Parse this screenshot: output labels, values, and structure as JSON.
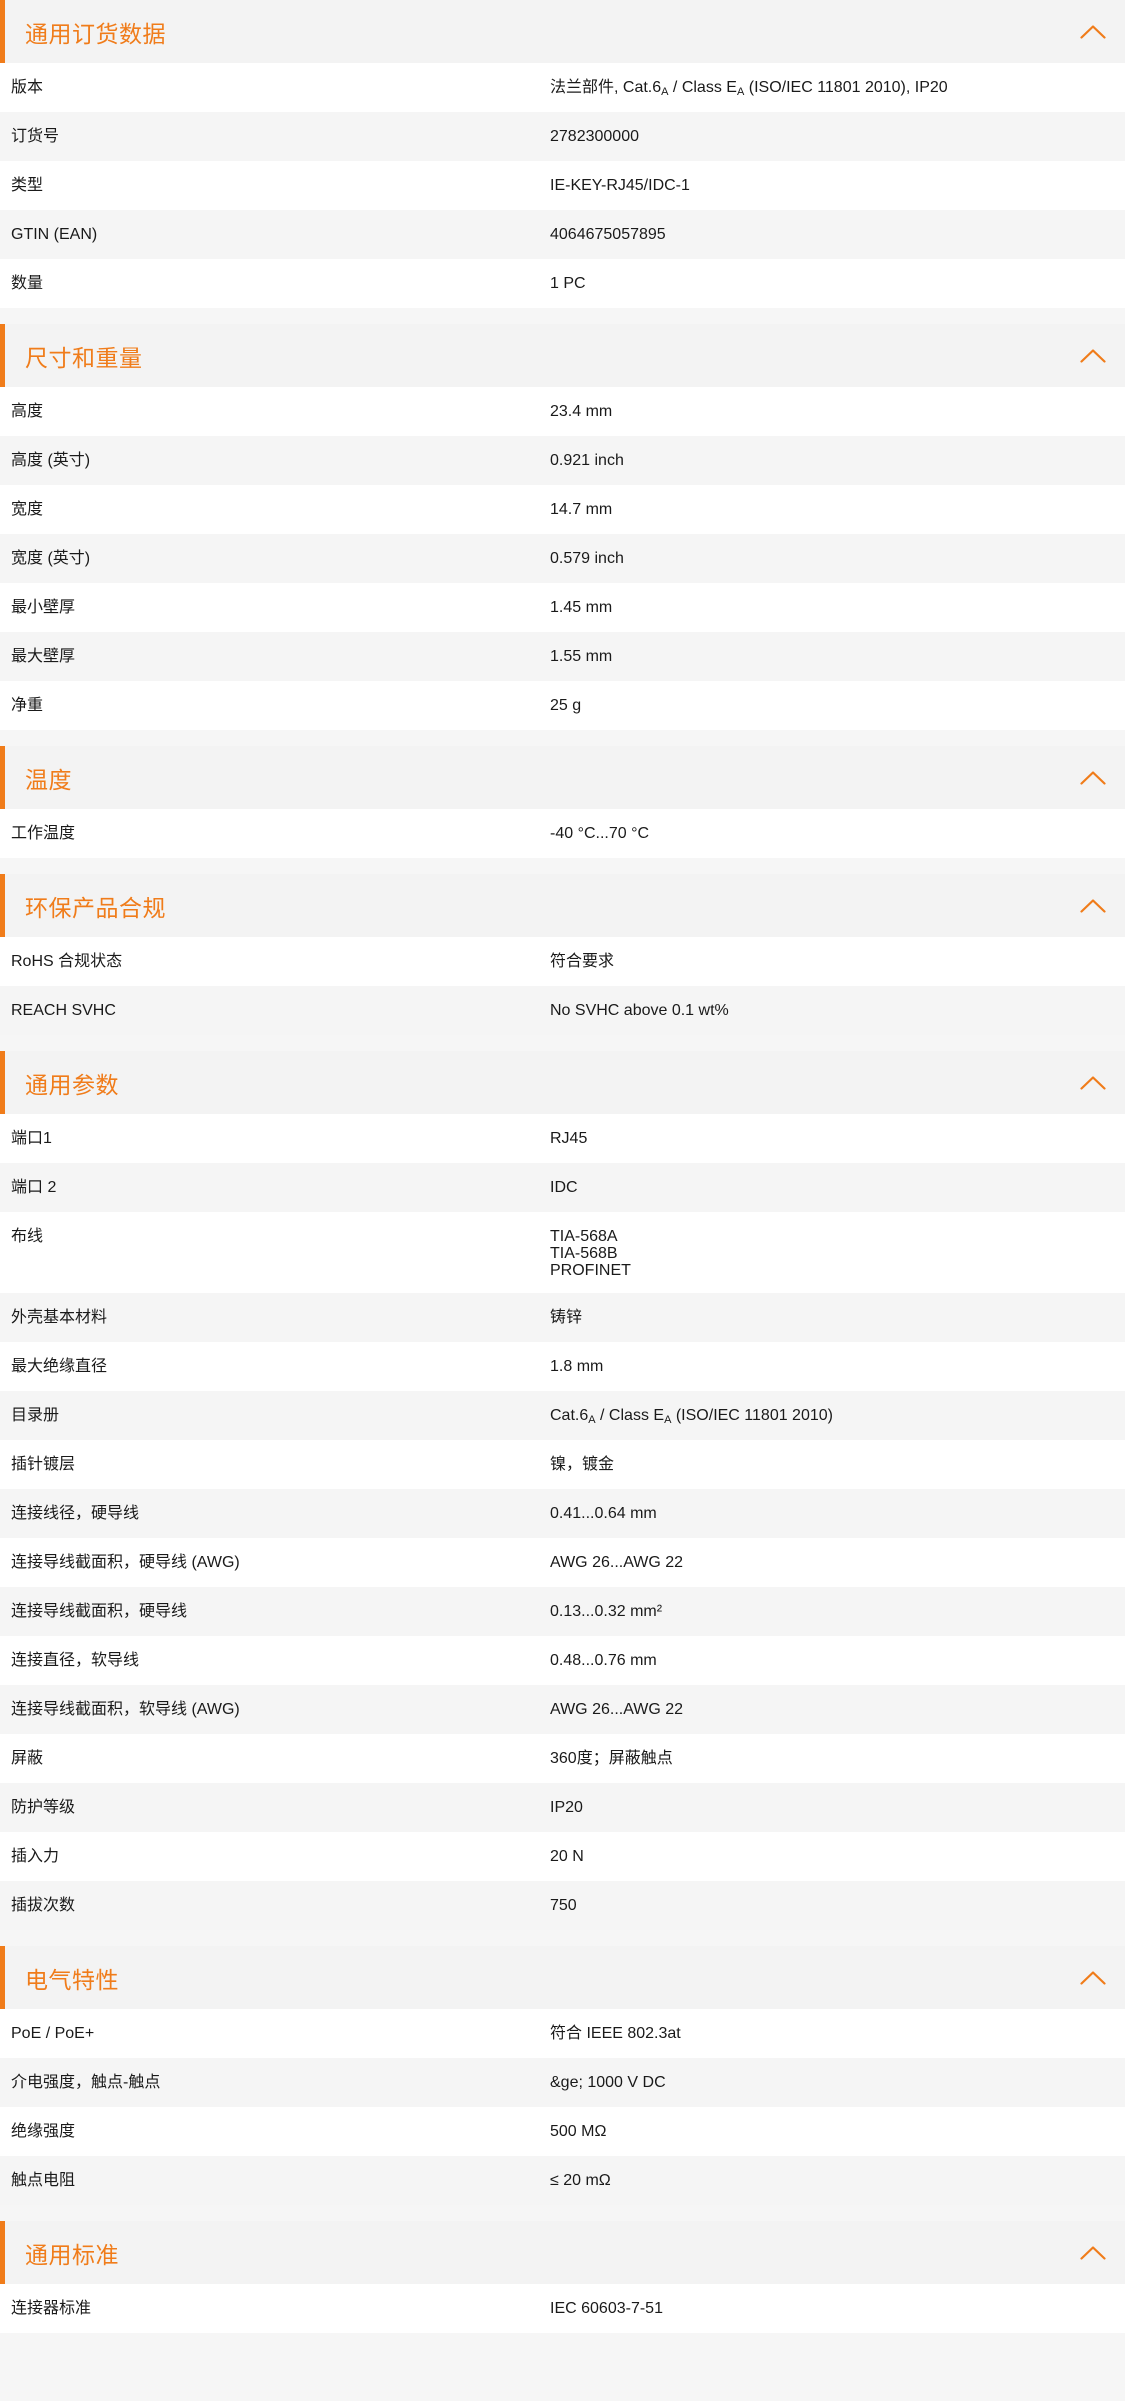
{
  "sections": [
    {
      "title": "通用订货数据",
      "rows": [
        {
          "label": "版本",
          "value": [
            "法兰部件, Cat.6",
            "A",
            " / Class E",
            "A",
            " (ISO/IEC 11801 2010), IP20"
          ]
        },
        {
          "label": "订货号",
          "value": [
            "2782300000"
          ]
        },
        {
          "label": "类型",
          "value": [
            "IE-KEY-RJ45/IDC-1"
          ]
        },
        {
          "label": "GTIN (EAN)",
          "value": [
            "4064675057895"
          ]
        },
        {
          "label": "数量",
          "value": [
            "1  PC"
          ]
        }
      ]
    },
    {
      "title": "尺寸和重量",
      "rows": [
        {
          "label": "高度",
          "value": [
            "23.4  mm"
          ]
        },
        {
          "label": "高度 (英寸)",
          "value": [
            "0.921  inch"
          ]
        },
        {
          "label": "宽度",
          "value": [
            "14.7  mm"
          ]
        },
        {
          "label": "宽度 (英寸)",
          "value": [
            "0.579  inch"
          ]
        },
        {
          "label": "最小壁厚",
          "value": [
            "1.45  mm"
          ]
        },
        {
          "label": "最大壁厚",
          "value": [
            "1.55  mm"
          ]
        },
        {
          "label": "净重",
          "value": [
            "25  g"
          ]
        }
      ]
    },
    {
      "title": "温度",
      "rows": [
        {
          "label": "工作温度",
          "value": [
            "-40 °C...70 °C"
          ]
        }
      ]
    },
    {
      "title": "环保产品合规",
      "rows": [
        {
          "label": "RoHS 合规状态",
          "value": [
            "符合要求"
          ]
        },
        {
          "label": "REACH SVHC",
          "value": [
            "No SVHC above 0.1 wt%"
          ]
        }
      ]
    },
    {
      "title": "通用参数",
      "rows": [
        {
          "label": "端口1",
          "value": [
            "RJ45"
          ]
        },
        {
          "label": "端口 2",
          "value": [
            "IDC"
          ]
        },
        {
          "label": "布线",
          "lines": [
            "TIA-568A",
            "TIA-568B",
            "PROFINET"
          ]
        },
        {
          "label": "外壳基本材料",
          "value": [
            "铸锌"
          ]
        },
        {
          "label": "最大绝缘直径",
          "value": [
            "1.8  mm"
          ]
        },
        {
          "label": "目录册",
          "value": [
            "Cat.6",
            "A",
            " / Class E",
            "A",
            " (ISO/IEC 11801 2010)"
          ]
        },
        {
          "label": "插针镀层",
          "value": [
            "镍，镀金"
          ]
        },
        {
          "label": "连接线径，硬导线",
          "value": [
            "0.41...0.64 mm"
          ]
        },
        {
          "label": "连接导线截面积，硬导线 (AWG)",
          "value": [
            "AWG 26...AWG 22"
          ]
        },
        {
          "label": "连接导线截面积，硬导线",
          "value": [
            "0.13...0.32 mm²"
          ]
        },
        {
          "label": "连接直径，软导线",
          "value": [
            "0.48...0.76 mm"
          ]
        },
        {
          "label": "连接导线截面积，软导线 (AWG)",
          "value": [
            "AWG 26...AWG 22"
          ]
        },
        {
          "label": "屏蔽",
          "value": [
            "360度；屏蔽触点"
          ]
        },
        {
          "label": "防护等级",
          "value": [
            "IP20"
          ]
        },
        {
          "label": "插入力",
          "value": [
            "20 N"
          ]
        },
        {
          "label": "插拔次数",
          "value": [
            "750"
          ]
        }
      ]
    },
    {
      "title": "电气特性",
      "rows": [
        {
          "label": "PoE / PoE+",
          "value": [
            "符合 IEEE 802.3at"
          ]
        },
        {
          "label": "介电强度，触点-触点",
          "value": [
            "&ge; 1000 V DC"
          ]
        },
        {
          "label": "绝缘强度",
          "value": [
            "500 MΩ"
          ]
        },
        {
          "label": "触点电阻",
          "value": [
            "≤ 20 mΩ"
          ]
        }
      ]
    },
    {
      "title": "通用标准",
      "rows": [
        {
          "label": "连接器标准",
          "value": [
            "IEC 60603-7-51"
          ]
        }
      ]
    }
  ],
  "colors": {
    "accent": "#f07c1a",
    "header_bg": "#f3f3f3",
    "row_alt_bg": "#f5f5f5"
  },
  "icons": {
    "section_toggle": "chevron-up-icon"
  }
}
